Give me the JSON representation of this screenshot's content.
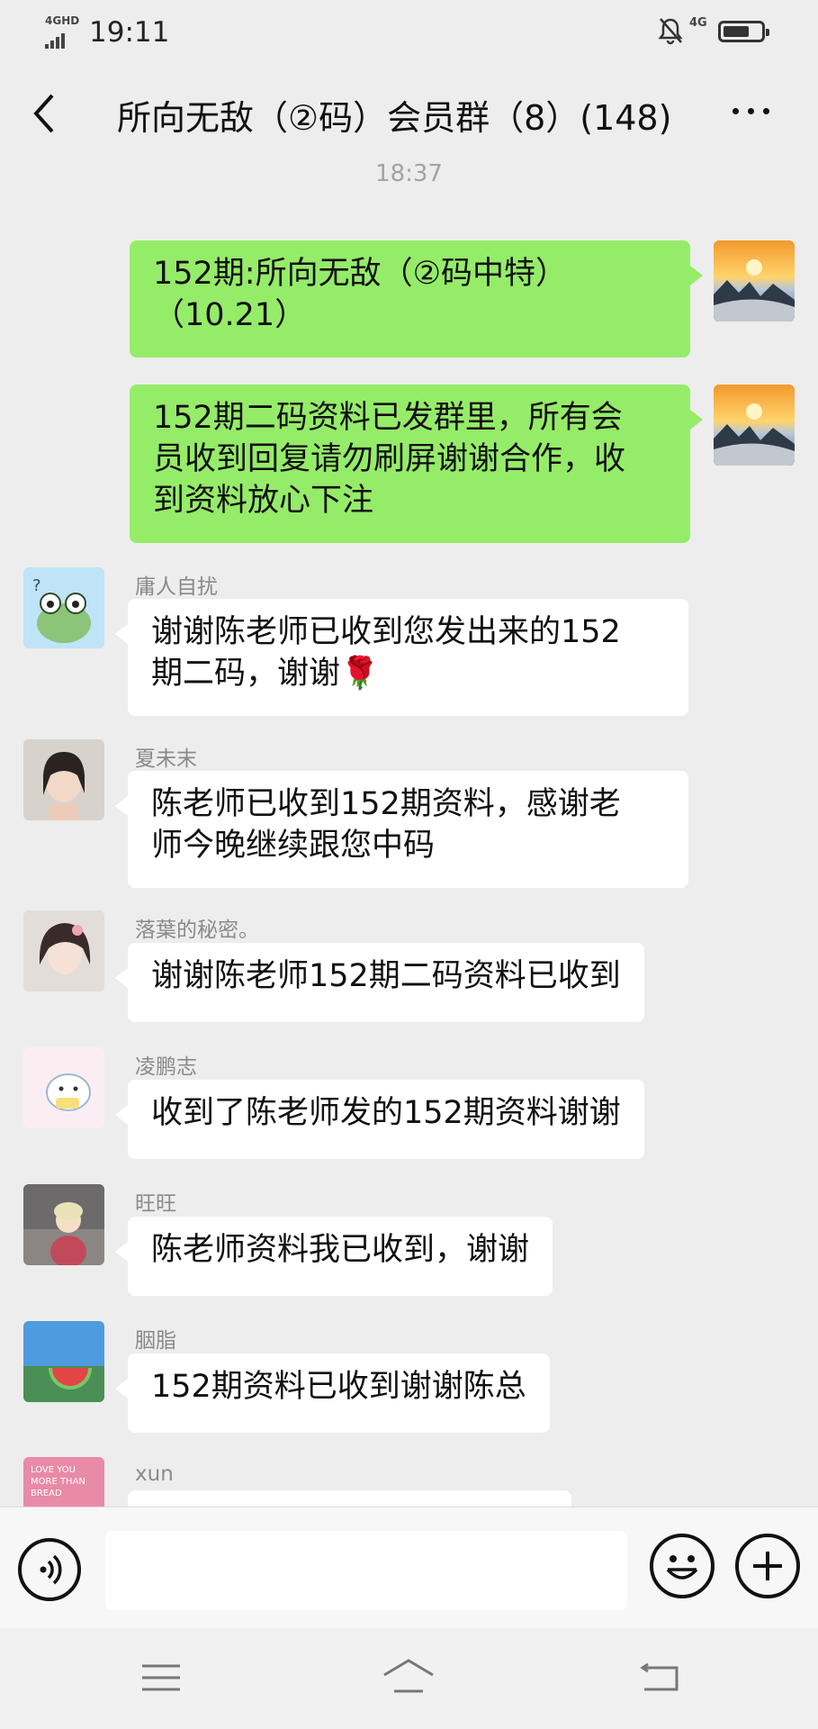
{
  "status_bar": {
    "network": "4GHD",
    "time": "19:11",
    "mobile_network": "4G"
  },
  "header": {
    "title": "所向无敌（②码）会员群（8）(148)"
  },
  "timestamp": "18:37",
  "messages": [
    {
      "type": "sent",
      "lines": [
        "152期:所向无敌（②码中特）",
        "（10.21）"
      ]
    },
    {
      "type": "sent",
      "lines": [
        "152期二码资料已发群里，所有会",
        "员收到回复请勿刷屏谢谢合作，收",
        "到资料放心下注"
      ]
    },
    {
      "type": "received",
      "name": "庸人自扰",
      "lines": [
        "谢谢陈老师已收到您发出来的152",
        "期二码，谢谢🌹"
      ]
    },
    {
      "type": "received",
      "name": "夏未末",
      "lines": [
        "陈老师已收到152期资料，感谢老",
        "师今晚继续跟您中码"
      ]
    },
    {
      "type": "received",
      "name": "落葉的秘密。",
      "lines": [
        "谢谢陈老师152期二码资料已收到"
      ]
    },
    {
      "type": "received",
      "name": "凌鹏志",
      "lines": [
        "收到了陈老师发的152期资料谢谢"
      ]
    },
    {
      "type": "received",
      "name": "旺旺",
      "lines": [
        "陈老师资料我已收到，谢谢"
      ]
    },
    {
      "type": "received",
      "name": "胭脂",
      "lines": [
        "152期资料已收到谢谢陈总"
      ]
    },
    {
      "type": "received",
      "name": "xun",
      "avatar_text": "LOVE YOU MORE THAN BREAD",
      "lines": []
    }
  ],
  "input_bar": {
    "placeholder": ""
  },
  "colors": {
    "sent_bubble": "#95ec69",
    "received_bubble": "#ffffff",
    "background": "#ededed"
  },
  "icons": [
    "back-arrow-icon",
    "more-dots-icon",
    "voice-icon",
    "emoji-icon",
    "plus-icon",
    "menu-icon",
    "home-icon",
    "back-nav-icon",
    "mute-bell-icon",
    "battery-icon",
    "signal-icon"
  ]
}
